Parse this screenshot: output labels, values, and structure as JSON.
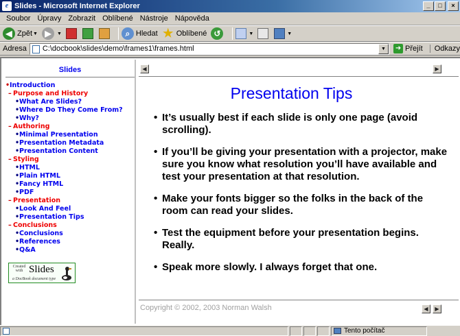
{
  "window": {
    "title": "Slides - Microsoft Internet Explorer",
    "buttons": {
      "minimize": "_",
      "maximize": "□",
      "close": "×"
    }
  },
  "menu": [
    "Soubor",
    "Úpravy",
    "Zobrazit",
    "Oblíbené",
    "Nástroje",
    "Nápověda"
  ],
  "toolbar": {
    "back_label": "Zpět",
    "search_label": "Hledat",
    "favorites_label": "Oblíbené"
  },
  "address": {
    "label": "Adresa",
    "value": "C:\\docbook\\slides\\demo\\frames1\\frames.html",
    "go_label": "Přejít",
    "links_label": "Odkazy"
  },
  "toc": {
    "title": "Slides",
    "items": [
      {
        "level": 0,
        "text": "Introduction"
      },
      {
        "level": 1,
        "text": "Purpose and History"
      },
      {
        "level": 2,
        "text": "What Are Slides?"
      },
      {
        "level": 2,
        "text": "Where Do They Come From?"
      },
      {
        "level": 2,
        "text": "Why?"
      },
      {
        "level": 1,
        "text": "Authoring"
      },
      {
        "level": 2,
        "text": "Minimal Presentation"
      },
      {
        "level": 2,
        "text": "Presentation Metadata"
      },
      {
        "level": 2,
        "text": "Presentation Content"
      },
      {
        "level": 1,
        "text": "Styling"
      },
      {
        "level": 2,
        "text": "HTML"
      },
      {
        "level": 2,
        "text": "Plain HTML"
      },
      {
        "level": 2,
        "text": "Fancy HTML"
      },
      {
        "level": 2,
        "text": "PDF"
      },
      {
        "level": 1,
        "text": "Presentation"
      },
      {
        "level": 2,
        "text": "Look And Feel"
      },
      {
        "level": 2,
        "text": "Presentation Tips"
      },
      {
        "level": 1,
        "text": "Conclusions"
      },
      {
        "level": 2,
        "text": "Conclusions"
      },
      {
        "level": 2,
        "text": "References"
      },
      {
        "level": 2,
        "text": "Q&A"
      }
    ],
    "logo": {
      "created_with": "Created with",
      "name": "Slides",
      "subtitle": "a DocBook document type"
    }
  },
  "slide": {
    "title": "Presentation Tips",
    "tips": [
      "It’s usually best if each slide is only one page (avoid scrolling).",
      "If you’ll be giving your presentation with a projector, make sure you know what resolution you’ll have available and test your presentation at that resolution.",
      "Make your fonts bigger so the folks in the back of the room can read your slides.",
      "Test the equipment before your presentation begins. Really.",
      "Speak more slowly. I always forget that one."
    ],
    "copyright": "Copyright © 2002, 2003 Norman Walsh"
  },
  "status": {
    "zone": "Tento počítač"
  },
  "colors": {
    "titlebar": "#0a246a",
    "link": "#0000ee",
    "section": "#ee0000"
  }
}
